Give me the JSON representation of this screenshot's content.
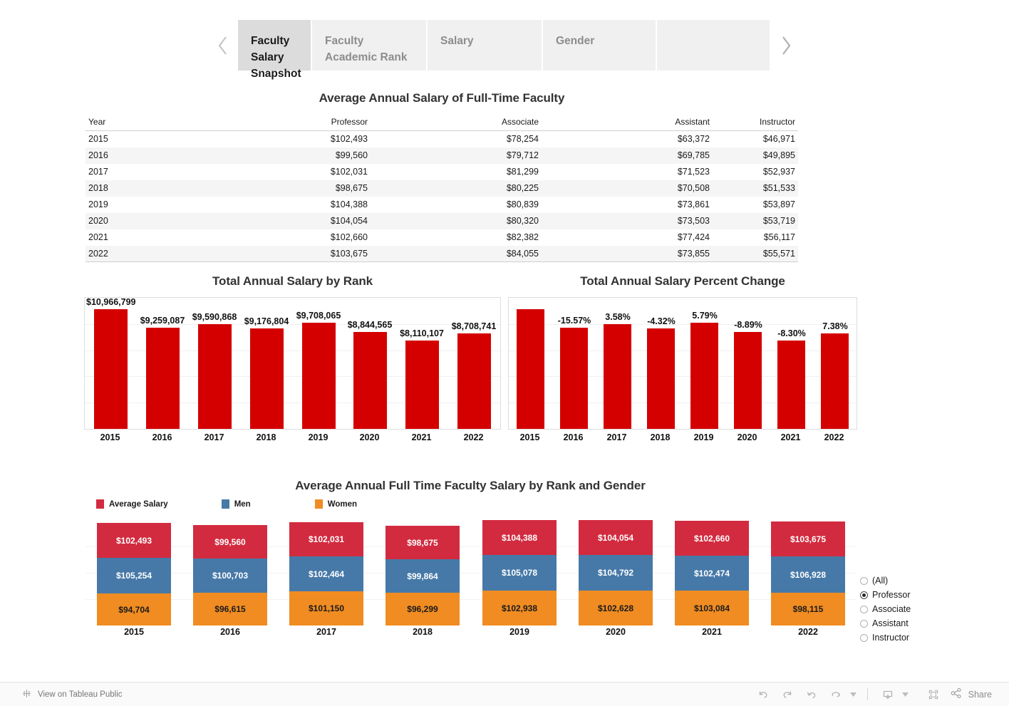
{
  "tabs": {
    "prev_icon": "chevron-left-icon",
    "next_icon": "chevron-right-icon",
    "items": [
      {
        "label": "Faculty Salary Snapshot",
        "active": true
      },
      {
        "label": "Faculty Academic Rank",
        "active": false
      },
      {
        "label": "Salary",
        "active": false
      },
      {
        "label": "Gender",
        "active": false
      },
      {
        "label": "",
        "active": false
      }
    ]
  },
  "crosstab": {
    "title": "Average Annual Salary of Full-Time Faculty",
    "columns": [
      "Year",
      "Professor",
      "Associate",
      "Assistant",
      "Instructor"
    ],
    "rows": [
      [
        "2015",
        "$102,493",
        "$78,254",
        "$63,372",
        "$46,971"
      ],
      [
        "2016",
        "$99,560",
        "$79,712",
        "$69,785",
        "$49,895"
      ],
      [
        "2017",
        "$102,031",
        "$81,299",
        "$71,523",
        "$52,937"
      ],
      [
        "2018",
        "$98,675",
        "$80,225",
        "$70,508",
        "$51,533"
      ],
      [
        "2019",
        "$104,388",
        "$80,839",
        "$73,861",
        "$53,897"
      ],
      [
        "2020",
        "$104,054",
        "$80,320",
        "$73,503",
        "$53,719"
      ],
      [
        "2021",
        "$102,660",
        "$82,382",
        "$77,424",
        "$56,117"
      ],
      [
        "2022",
        "$103,675",
        "$84,055",
        "$73,855",
        "$55,571"
      ]
    ]
  },
  "rank_filter": {
    "options": [
      {
        "label": "(All)",
        "selected": false
      },
      {
        "label": "Professor",
        "selected": true
      },
      {
        "label": "Associate",
        "selected": false
      },
      {
        "label": "Assistant",
        "selected": false
      },
      {
        "label": "Instructor",
        "selected": false
      }
    ]
  },
  "toolbar": {
    "tableau_link": "View on Tableau Public",
    "tableau_icon": "tableau-logo-icon",
    "undo_icon": "undo-icon",
    "redo_icon": "redo-icon",
    "revert_icon": "revert-icon",
    "refresh_icon": "refresh-icon",
    "refresh_caret_icon": "caret-down-icon",
    "download_icon": "download-icon",
    "download_caret_icon": "caret-down-icon",
    "fullscreen_icon": "fullscreen-icon",
    "share_icon": "share-icon",
    "share_label": "Share"
  },
  "colors": {
    "bar_red": "#d40000",
    "avg_salary": "#d22b3f",
    "men": "#4679a8",
    "women": "#f08c22",
    "tab_active_bg": "#dcdcdc",
    "tab_bg": "#f0f0f0"
  },
  "chart_data": [
    {
      "type": "bar",
      "title": "Total Annual Salary by Rank",
      "xlabel": "",
      "ylabel": "",
      "grid": true,
      "categories": [
        "2015",
        "2016",
        "2017",
        "2018",
        "2019",
        "2020",
        "2021",
        "2022"
      ],
      "values": [
        10966799,
        9259087,
        9590868,
        9176804,
        9708065,
        8844565,
        8110107,
        8708741
      ],
      "data_labels": [
        "$10,966,799",
        "$9,259,087",
        "$9,590,868",
        "$9,176,804",
        "$9,708,065",
        "$8,844,565",
        "$8,110,107",
        "$8,708,741"
      ],
      "ylim": [
        0,
        12000000
      ]
    },
    {
      "type": "bar",
      "title": "Total Annual Salary Percent Change",
      "xlabel": "",
      "ylabel": "",
      "grid": true,
      "categories": [
        "2015",
        "2016",
        "2017",
        "2018",
        "2019",
        "2020",
        "2021",
        "2022"
      ],
      "values": [
        10966799,
        9259087,
        9590868,
        9176804,
        9708065,
        8844565,
        8110107,
        8708741
      ],
      "data_labels": [
        "",
        "-15.57%",
        "3.58%",
        "-4.32%",
        "5.79%",
        "-8.89%",
        "-8.30%",
        "7.38%"
      ],
      "pct_change": [
        null,
        -15.57,
        3.58,
        -4.32,
        5.79,
        -8.89,
        -8.3,
        7.38
      ],
      "ylim": [
        0,
        12000000
      ]
    },
    {
      "type": "bar",
      "title": "Average Annual Full Time Faculty Salary by Rank and Gender",
      "stacked": true,
      "legend_position": "top-left",
      "categories": [
        "2015",
        "2016",
        "2017",
        "2018",
        "2019",
        "2020",
        "2021",
        "2022"
      ],
      "series": [
        {
          "name": "Average Salary",
          "color": "#d22b3f",
          "values": [
            102493,
            99560,
            102031,
            98675,
            104388,
            104054,
            102660,
            103675
          ],
          "labels": [
            "$102,493",
            "$99,560",
            "$102,031",
            "$98,675",
            "$104,388",
            "$104,054",
            "$102,660",
            "$103,675"
          ]
        },
        {
          "name": "Men",
          "color": "#4679a8",
          "values": [
            105254,
            100703,
            102464,
            99864,
            105078,
            104792,
            102474,
            106928
          ],
          "labels": [
            "$105,254",
            "$100,703",
            "$102,464",
            "$99,864",
            "$105,078",
            "$104,792",
            "$102,474",
            "$106,928"
          ]
        },
        {
          "name": "Women",
          "color": "#f08c22",
          "values": [
            94704,
            96615,
            101150,
            96299,
            102938,
            102628,
            103084,
            98115
          ],
          "labels": [
            "$94,704",
            "$96,615",
            "$101,150",
            "$96,299",
            "$102,938",
            "$102,628",
            "$103,084",
            "$98,115"
          ]
        }
      ]
    }
  ]
}
